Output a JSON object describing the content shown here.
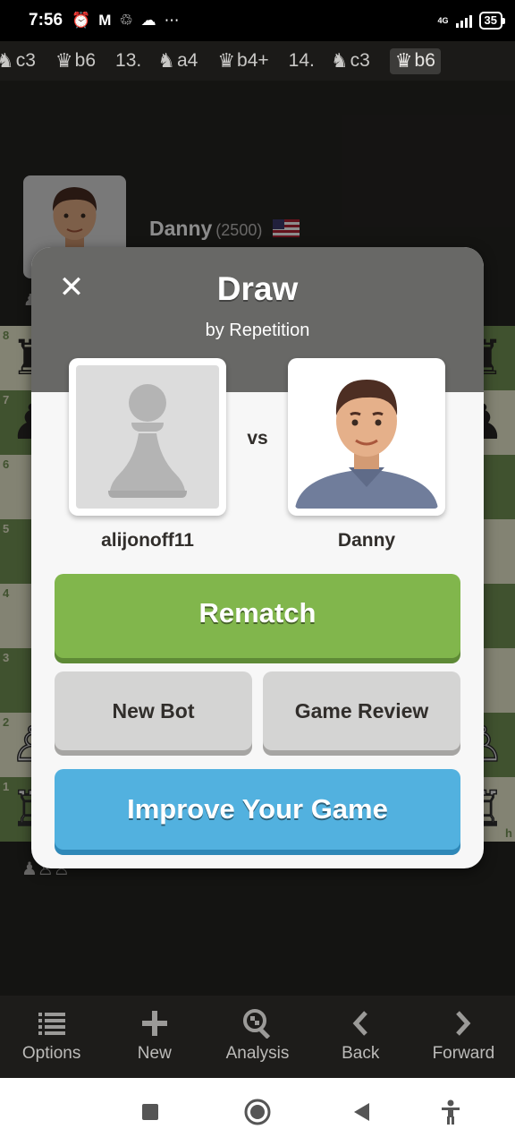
{
  "status_bar": {
    "time": "7:56",
    "icons": [
      "alarm-icon",
      "gmail-icon",
      "sync-icon",
      "cloud-icon",
      "more-dots-icon"
    ],
    "network": "4G",
    "battery": "35"
  },
  "move_list": [
    {
      "piece": "♞",
      "square": "c3",
      "kind": "move"
    },
    {
      "piece": "♛",
      "square": "b6",
      "kind": "move"
    },
    {
      "piece": "",
      "square": "13.",
      "kind": "num"
    },
    {
      "piece": "♞",
      "square": "a4",
      "kind": "move"
    },
    {
      "piece": "♛",
      "square": "b4+",
      "kind": "move"
    },
    {
      "piece": "",
      "square": "14.",
      "kind": "num"
    },
    {
      "piece": "♞",
      "square": "c3",
      "kind": "move"
    },
    {
      "piece": "♛",
      "square": "b6",
      "kind": "current"
    }
  ],
  "opponent": {
    "name": "Danny",
    "rating": "(2500)",
    "flag": "us-flag",
    "captured": "♟"
  },
  "player": {
    "captured": "♟♙♙"
  },
  "board": {
    "ranks": [
      "8",
      "7",
      "6",
      "5",
      "4",
      "3",
      "2",
      "1"
    ],
    "file_label": "h",
    "pieces": [
      {
        "row": 0,
        "col": 0,
        "glyph": "♜",
        "side": "b"
      },
      {
        "row": 0,
        "col": 7,
        "glyph": "♜",
        "side": "b"
      },
      {
        "row": 1,
        "col": 0,
        "glyph": "♟",
        "side": "b"
      },
      {
        "row": 1,
        "col": 7,
        "glyph": "♟",
        "side": "b"
      },
      {
        "row": 6,
        "col": 0,
        "glyph": "♙",
        "side": "w"
      },
      {
        "row": 6,
        "col": 7,
        "glyph": "♙",
        "side": "w"
      },
      {
        "row": 7,
        "col": 0,
        "glyph": "♖",
        "side": "w"
      },
      {
        "row": 7,
        "col": 7,
        "glyph": "♖",
        "side": "w"
      }
    ]
  },
  "modal": {
    "title": "Draw",
    "subtitle": "by Repetition",
    "vs": "vs",
    "player_left": "alijonoff11",
    "player_right": "Danny",
    "rematch": "Rematch",
    "new_bot": "New Bot",
    "game_review": "Game Review",
    "improve": "Improve Your Game"
  },
  "toolbar": {
    "options": "Options",
    "new": "New",
    "analysis": "Analysis",
    "back": "Back",
    "forward": "Forward"
  },
  "colors": {
    "board_light": "#eeeed2",
    "board_dark": "#769656",
    "rematch_green": "#81b64c",
    "improve_blue": "#52b1df",
    "button_gray": "#d4d4d3"
  }
}
